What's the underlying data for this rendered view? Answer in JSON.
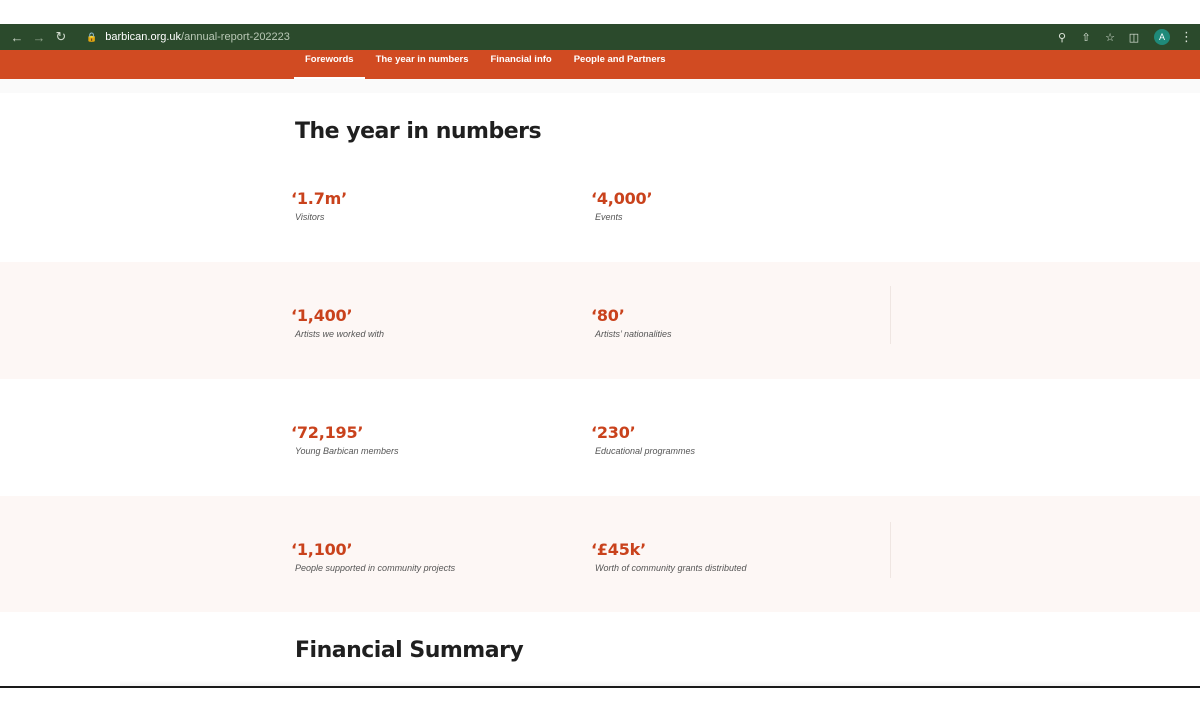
{
  "browser": {
    "url_host": "barbican.org.uk",
    "url_path": "/annual-report-202223",
    "avatar_letter": "A"
  },
  "nav": {
    "items": [
      {
        "label": "Forewords",
        "active": true
      },
      {
        "label": "The year in numbers",
        "active": false
      },
      {
        "label": "Financial info",
        "active": false
      },
      {
        "label": "People and Partners",
        "active": false
      }
    ]
  },
  "year_in_numbers": {
    "title": "The year in numbers",
    "stats": [
      {
        "value": "‘1.7m’",
        "label": "Visitors"
      },
      {
        "value": "‘4,000’",
        "label": "Events"
      },
      {
        "value": "‘1,400’",
        "label": "Artists we worked with"
      },
      {
        "value": "‘80’",
        "label": "Artists’ nationalities"
      },
      {
        "value": "‘72,195’",
        "label": "Young Barbican members"
      },
      {
        "value": "‘230’",
        "label": "Educational programmes"
      },
      {
        "value": "‘1,100’",
        "label": "People supported in community projects"
      },
      {
        "value": "‘£45k’",
        "label": "Worth of community grants distributed"
      }
    ]
  },
  "financial_summary": {
    "title": "Financial Summary"
  },
  "colors": {
    "browser_bar": "#2b4a2c",
    "nav_bar": "#d14b22",
    "stat_value": "#c9421c",
    "tint_band": "#fdf7f5"
  }
}
